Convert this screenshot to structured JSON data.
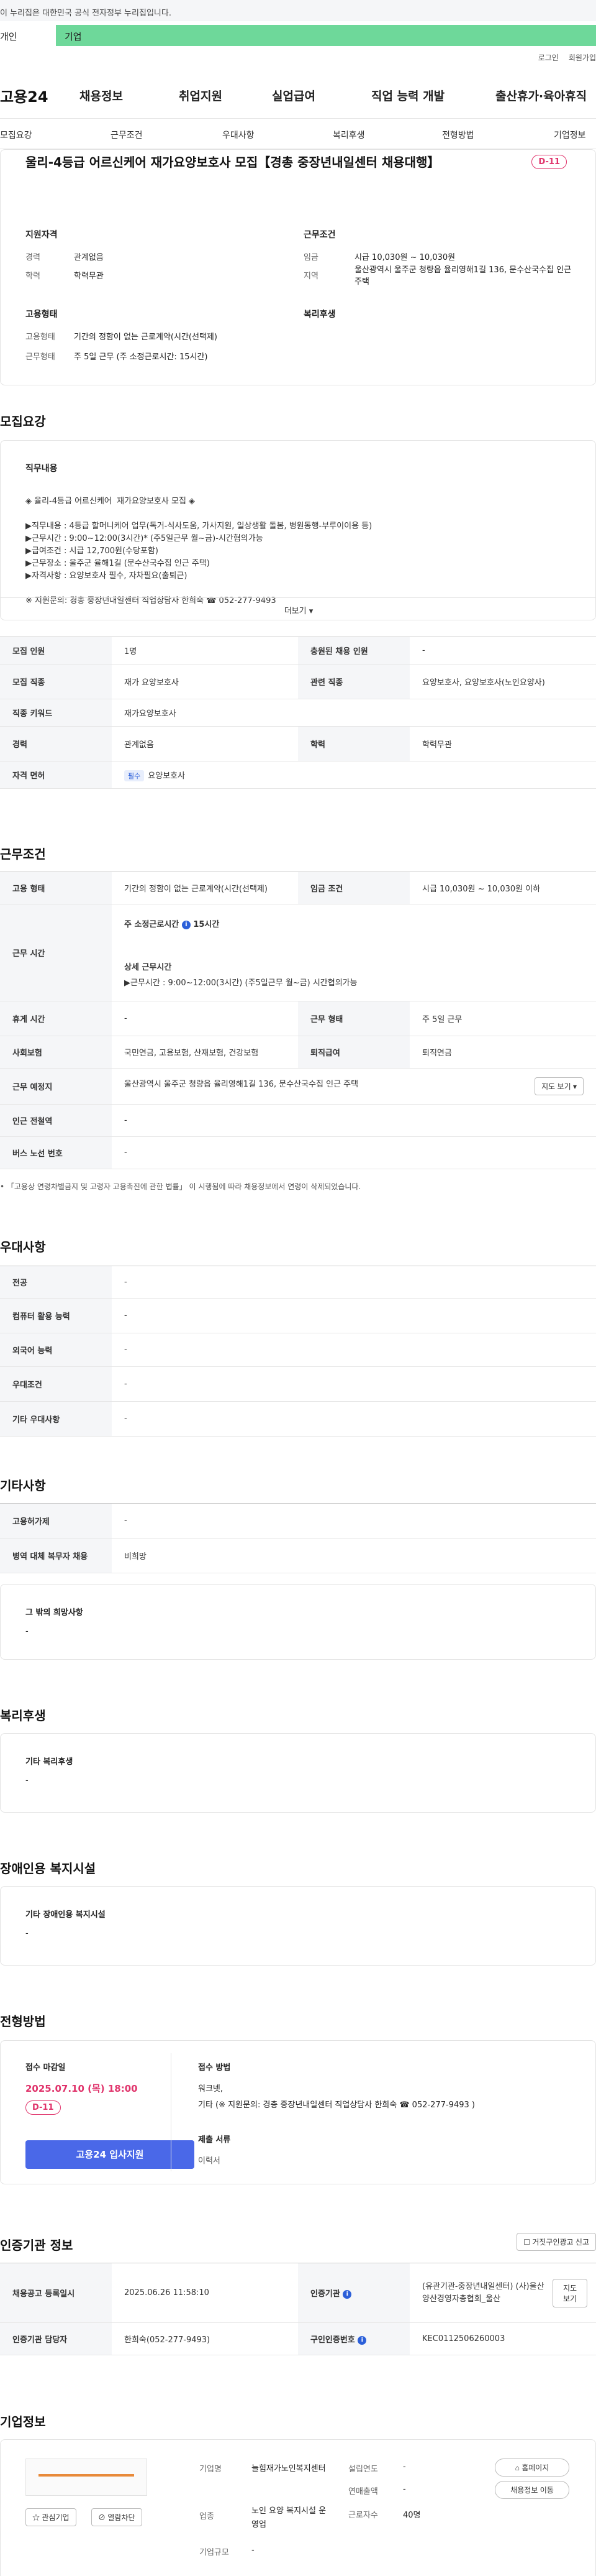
{
  "gov_banner": "이 누리집은 대한민국 공식 전자정부 누리집입니다.",
  "top_tabs": {
    "individual": "개인",
    "corporate": "기업"
  },
  "util": {
    "login": "로그인",
    "signup": "회원가입"
  },
  "logo": "고용24",
  "gnb": [
    "채용정보",
    "취업지원",
    "실업급여",
    "직업 능력 개발",
    "출산휴가·육아휴직"
  ],
  "subnav": [
    "모집요강",
    "근무조건",
    "우대사항",
    "복리후생",
    "전형방법",
    "기업정보"
  ],
  "job": {
    "title": "울리-4등급 어르신케어 재가요양보호사 모집【경총 중장년내일센터 채용대행】",
    "dday": "D-11",
    "qual_h": "지원자격",
    "cond_h": "근무조건",
    "career_l": "경력",
    "career_v": "관계없음",
    "edu_l": "학력",
    "edu_v": "학력무관",
    "wage_l": "임금",
    "wage_v": "시급 10,030원 ~ 10,030원",
    "region_l": "지역",
    "region_v": "울산광역시 울주군 청량읍 율리영해1길 136, 문수산국수집 인근 주택",
    "emp_h": "고용형태",
    "welfare_h": "복리후생",
    "emptype_l": "고용형태",
    "emptype_v": "기간의 정함이 없는 근로계약(시간(선택제)",
    "worktype_l": "근무형태",
    "worktype_v": "주 5일 근무 (주 소정근로시간: 15시간)"
  },
  "recruit": {
    "title": "모집요강",
    "duty_h": "직무내용",
    "duty_lines": [
      "◈ 율리-4등급 어르신케어  재가요양보호사 모집 ◈",
      "",
      "▶직무내용 : 4등급 할머니케어 업무(독거-식사도움, 가사지원, 일상생활 돌봄, 병원동행-부루이이용 등)",
      "▶근무시간 : 9:00~12:00(3시간)* (주5일근무 월~금)-시간협의가능",
      "▶급여조건 : 시급 12,700원(수당포함)",
      "▶근무장소 : 울주군 율해1길 (문수산국수집 인근 주택)",
      "▶자격사항 : 요양보호사 필수, 자차필요(출퇴근)",
      "",
      "※ 지원문의: 경총 중장년내일센터 직업상담사 한희숙 ☎ 052-277-9493"
    ],
    "more": "더보기 ▾",
    "rows": [
      [
        "모집 인원",
        "1명",
        "충원된 채용 인원",
        "-"
      ],
      [
        "모집 직종",
        "재가 요양보호사",
        "관련 직종",
        "요양보호사, 요양보호사(노인요양사)"
      ],
      [
        "직종 키워드",
        "재가요양보호사",
        "",
        ""
      ],
      [
        "경력",
        "관계없음",
        "학력",
        "학력무관"
      ],
      [
        "자격 면허",
        "요양보호사",
        "",
        ""
      ]
    ],
    "badge": "필수"
  },
  "work": {
    "title": "근무조건",
    "emp_l": "고용 형태",
    "emp_v": "기간의 정함이 없는 근로계약(시간(선택제)",
    "wage_l": "임금 조건",
    "wage_v": "시급 10,030원 ~ 10,030원 이하",
    "time_l": "근무 시간",
    "time_a": "주 소정근로시간",
    "time_a_v": "15시간",
    "time_b": "상세 근무시간",
    "time_b_v": "▶근무시간 : 9:00~12:00(3시간) (주5일근무 월~금) 시간협의가능",
    "holiday_l": "휴게 시간",
    "holiday_v": "-",
    "wtype_l": "근무 형태",
    "wtype_v": "주 5일 근무",
    "ins_l": "사회보험",
    "ins_v": "국민연금, 고용보험, 산재보험, 건강보험",
    "ret_l": "퇴직급여",
    "ret_v": "퇴직연금",
    "place_l": "근무 예정지",
    "place_v": "울산광역시 울주군 청량읍 율리영해1길 136, 문수산국수집 인근 주택",
    "map_btn": "지도 보기 ▾",
    "subway_l": "인근 전철역",
    "subway_v": "-",
    "bus_l": "버스 노선 번호",
    "bus_v": "-",
    "note": "• 「고용상 연령차별금지 및 고령자 고용촉진에 관한 법률」 이 시행됨에 따라 채용정보에서 연령이 삭제되었습니다."
  },
  "pref": {
    "title": "우대사항",
    "rows": [
      [
        "전공",
        "-"
      ],
      [
        "컴퓨터 활용 능력",
        "-"
      ],
      [
        "외국어 능력",
        "-"
      ],
      [
        "우대조건",
        "-"
      ],
      [
        "기타 우대사항",
        "-"
      ]
    ]
  },
  "etc": {
    "title": "기타사항",
    "rows": [
      [
        "고용허가제",
        "-"
      ],
      [
        "병역 대체 복무자 채용",
        "비희망"
      ]
    ],
    "box_h": "그 밖의 희망사항",
    "box_v": "-"
  },
  "welfare": {
    "title": "복리후생",
    "box_h": "기타 복리후생",
    "box_v": "-"
  },
  "disabled": {
    "title": "장애인용 복지시설",
    "box_h": "기타 장애인용 복지시설",
    "box_v": "-"
  },
  "process": {
    "title": "전형방법",
    "deadline_h": "접수 마감일",
    "deadline_v": "2025.07.10 (목) 18:00",
    "dday": "D-11",
    "apply_btn": "고용24 입사지원",
    "method_h": "접수 방법",
    "method_v1": "워크넷,",
    "method_v2": "기타 (※ 지원문의: 경총 중장년내일센터 직업상담사 한희숙 ☎ 052-277-9493 )",
    "docs_h": "제출 서류",
    "docs_v": "이력서"
  },
  "cert": {
    "title": "인증기관 정보",
    "report_btn": "거짓구인광고 신고",
    "r1_l": "채용공고 등록일시",
    "r1_v": "2025.06.26 11:58:10",
    "r2_l": "인증기관",
    "r2_v": "(유관기관-중장년내일센터) (사)울산양산경영자총협회_울산",
    "r2_btn": "지도 보기",
    "r3_l": "인증기관 담당자",
    "r3_v": "한희숙(052-277-9493)",
    "r4_l": "구인인증번호",
    "r4_v": "KEC0112506260003"
  },
  "company": {
    "title": "기업정보",
    "fav_btn": "관심기업",
    "block_btn": "열람차단",
    "name_l": "기업명",
    "name_v": "늘힘재가노인복지센터",
    "found_l": "설립연도",
    "found_v": "-",
    "sales_l": "연매출액",
    "sales_v": "-",
    "ind_l": "업종",
    "ind_v": "노인 요양 복지시설 운영업",
    "emp_l": "근로자수",
    "emp_v": "40명",
    "scale_l": "기업규모",
    "scale_v": "-",
    "home_btn": "홈페이지",
    "jobs_btn": "채용정보 이동"
  }
}
